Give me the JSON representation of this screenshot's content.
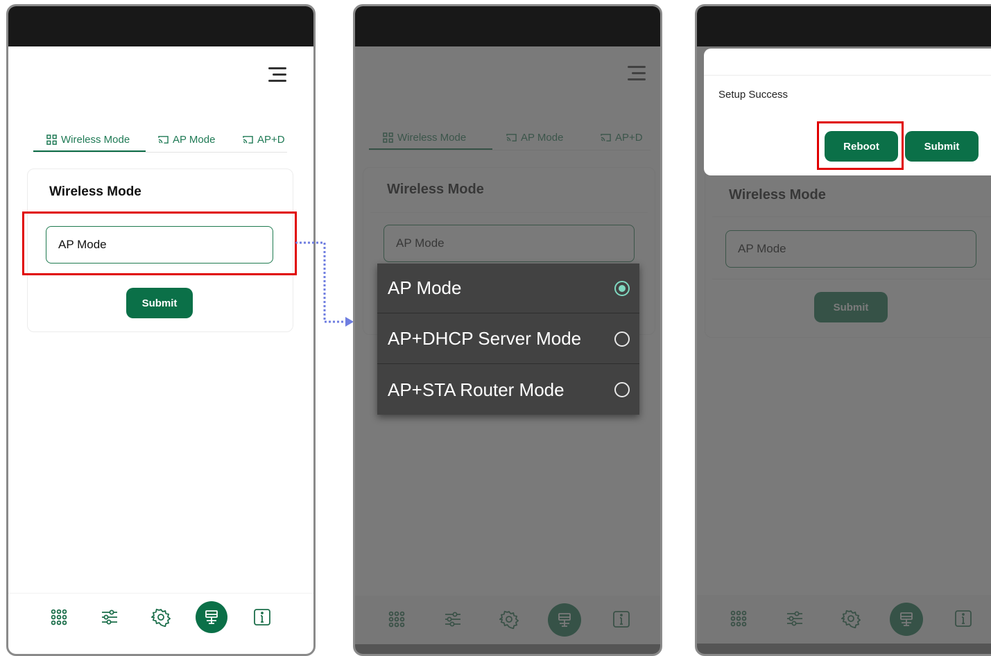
{
  "menu_icon": "hamburger-menu-icon",
  "tabs": [
    {
      "label": "Wireless Mode",
      "icon": "grid-icon"
    },
    {
      "label": "AP Mode",
      "icon": "cast-icon"
    },
    {
      "label": "AP+D",
      "icon": "cast-icon"
    }
  ],
  "card": {
    "title": "Wireless Mode"
  },
  "select": {
    "value": "AP Mode"
  },
  "submit_label": "Submit",
  "dropdown": {
    "options": [
      {
        "label": "AP Mode",
        "selected": true
      },
      {
        "label": "AP+DHCP Server Mode",
        "selected": false
      },
      {
        "label": "AP+STA Router Mode",
        "selected": false
      }
    ]
  },
  "dialog": {
    "message": "Setup Success",
    "reboot_label": "Reboot",
    "submit_label": "Submit"
  },
  "bottom_nav": [
    "apps-grid-icon",
    "sliders-icon",
    "gear-icon",
    "router-icon",
    "info-icon"
  ],
  "colors": {
    "accent": "#0b7048",
    "highlight": "#e00000",
    "connector": "#6f7ee0",
    "overlay": "#464646"
  }
}
